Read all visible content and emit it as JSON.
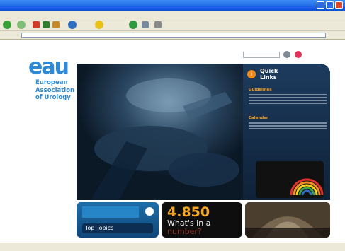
{
  "colors": {
    "brand_blue": "#2e8ad6",
    "accent_orange": "#f0a02a",
    "hero_dark": "#0d1c2c",
    "xp_titlebar": "#0a4fd6"
  },
  "window": {
    "title": "",
    "controls": {
      "minimize_icon": "minimize-icon",
      "maximize_icon": "maximize-icon",
      "close_icon": "close-icon"
    }
  },
  "toolbar": {
    "icons": [
      "back-icon",
      "forward-icon",
      "stop-icon",
      "refresh-icon",
      "home-icon",
      "search-icon",
      "favorites-icon",
      "history-icon",
      "mail-icon",
      "print-icon"
    ]
  },
  "address": {
    "value": ""
  },
  "site": {
    "logo": "eau",
    "org_name": "European Association of Urology",
    "top_nav": [],
    "search": {
      "placeholder": ""
    },
    "sidebar": [],
    "quick_links": {
      "title": "Quick Links",
      "links": [
        {
          "label": "Guidelines"
        },
        {
          "label": "Calendar"
        }
      ]
    },
    "tiles": {
      "top_topics": "Top Topics",
      "number": "4.850",
      "number_text": "What's in a",
      "number_text_dim": "number?"
    }
  },
  "status": {
    "left": "",
    "right": ""
  }
}
